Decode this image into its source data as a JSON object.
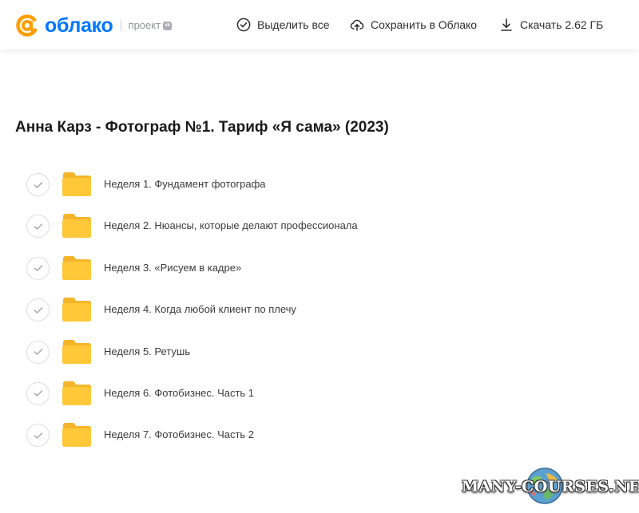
{
  "header": {
    "logo_text": "облако",
    "project_label": "проект",
    "vk_badge": "vk",
    "actions": {
      "select_all": "Выделить все",
      "save_to_cloud": "Сохранить в Облако",
      "download": "Скачать 2.62 ГБ"
    }
  },
  "page": {
    "title": "Анна Карз - Фотограф №1. Тариф «Я сама» (2023)"
  },
  "folders": [
    {
      "name": "Неделя 1. Фундамент фотографа"
    },
    {
      "name": "Неделя 2. Нюансы, которые делают профессионала"
    },
    {
      "name": "Неделя 3. «Рисуем в кадре»"
    },
    {
      "name": "Неделя 4. Когда любой клиент по плечу"
    },
    {
      "name": "Неделя 5. Ретушь"
    },
    {
      "name": "Неделя 6. Фотобизнес. Часть 1"
    },
    {
      "name": "Неделя 7. Фотобизнес. Часть 2"
    }
  ],
  "watermark": {
    "text": "MANY-COURSES.NET"
  },
  "colors": {
    "brand_blue": "#0077ff",
    "brand_orange": "#ff9e00",
    "folder_yellow": "#ffc839"
  }
}
